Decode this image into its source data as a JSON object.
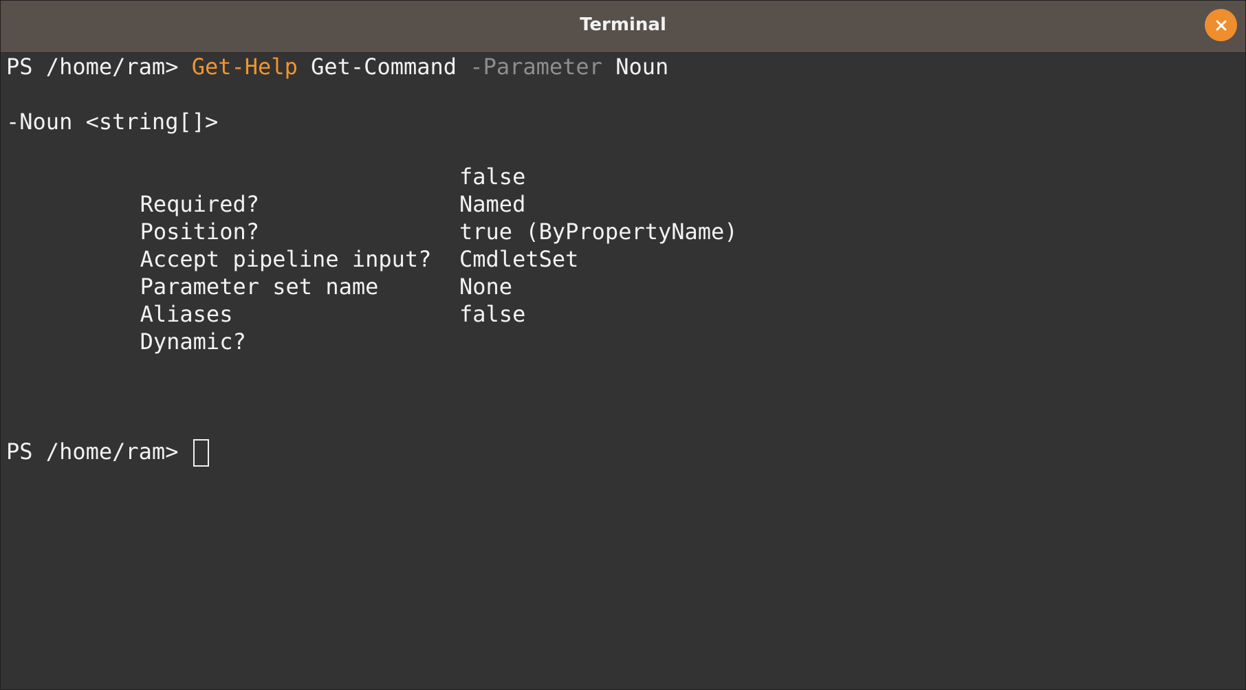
{
  "window": {
    "title": "Terminal",
    "close_icon": "close-icon",
    "accent_color": "#ee8e2e"
  },
  "terminal": {
    "command_line": {
      "prompt": "PS /home/ram> ",
      "cmdlet": "Get-Help",
      "argument": "Get-Command",
      "parameter": "-Parameter",
      "parameter_value": "Noun"
    },
    "param_header": "-Noun <string[]>",
    "properties": [
      {
        "label": "Required?",
        "value": "false"
      },
      {
        "label": "Position?",
        "value": "Named"
      },
      {
        "label": "Accept pipeline input?",
        "value": "true (ByPropertyName)"
      },
      {
        "label": "Parameter set name",
        "value": "CmdletSet"
      },
      {
        "label": "Aliases",
        "value": "None"
      },
      {
        "label": "Dynamic?",
        "value": "false"
      }
    ],
    "current_prompt": "PS /home/ram> ",
    "colors": {
      "cmdlet": "#ef9530",
      "parameter": "#8e8e8e",
      "text": "#f2f2f2",
      "background": "#333333"
    }
  }
}
